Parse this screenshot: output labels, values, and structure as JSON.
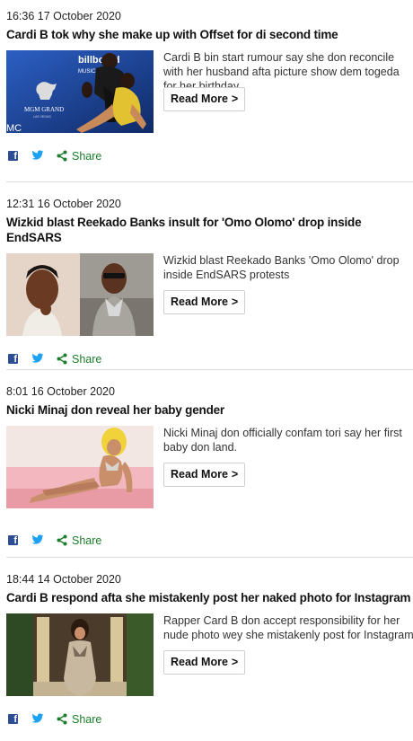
{
  "articles": [
    {
      "timestamp": "16:36 17 October 2020",
      "headline": "Cardi B tok why she make up with Offset for di second time",
      "summary": "Cardi B bin start rumour say she don reconcile with her husband afta picture show dem togeda for her birthday.",
      "read_more": "Read More",
      "share": "Share",
      "image_text": [
        "billboard",
        "MUSIC A",
        "MGM GRAND",
        "LAS VEGAS",
        "MC"
      ]
    },
    {
      "timestamp": "12:31 16 October 2020",
      "headline": "Wizkid blast Reekado Banks insult for 'Omo Olomo' drop inside EndSARS",
      "summary": "Wizkid blast Reekado Banks 'Omo Olomo' drop inside EndSARS protests",
      "read_more": "Read More",
      "share": "Share"
    },
    {
      "timestamp": "8:01 16 October 2020",
      "headline": "Nicki Minaj don reveal her baby gender",
      "summary": "Nicki Minaj don officially confam tori say her first baby don land.",
      "read_more": "Read More",
      "share": "Share"
    },
    {
      "timestamp": "18:44 14 October 2020",
      "headline": "Cardi B respond afta she mistakenly post her naked photo for Instagram",
      "summary": "Rapper Card B don accept responsibility for her nude photo wey she mistakenly post for Instagram",
      "read_more": "Read More",
      "share": "Share"
    }
  ],
  "icons": {
    "facebook": "facebook-icon",
    "twitter": "twitter-icon",
    "share": "share-icon",
    "chevron": ">"
  },
  "colors": {
    "facebook": "#2e4e94",
    "twitter": "#1da1f2",
    "share": "#1b7d2a"
  }
}
